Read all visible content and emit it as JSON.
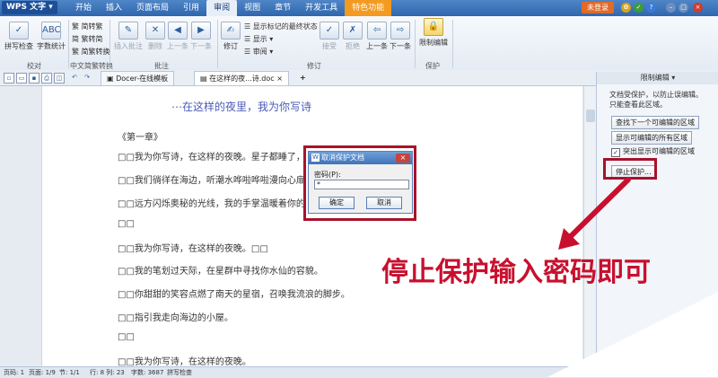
{
  "app": {
    "name": "WPS 文字",
    "login": "未登录"
  },
  "menu_tabs": [
    "开始",
    "插入",
    "页面布局",
    "引用",
    "审阅",
    "视图",
    "章节",
    "开发工具",
    "特色功能"
  ],
  "ribbon": {
    "spell_check": "拼写检查",
    "word_count": "字数统计",
    "proof_group": "校对",
    "simp_to_trad": "简转繁",
    "trad_to_simp": "繁转简",
    "simp_trad_convert": "简繁转换",
    "chinese_group": "中文简繁转换",
    "insert_comment": "插入批注",
    "delete": "删除",
    "prev_comment": "上一条",
    "next_comment": "下一条",
    "comment_group": "批注",
    "revise": "修订",
    "markup_state": "显示标记的最终状态",
    "show": "显示",
    "review": "审阅",
    "accept": "接受",
    "reject": "拒绝",
    "prev_change": "上一条",
    "next_change": "下一条",
    "revision_group": "修订",
    "restrict_edit": "限制编辑",
    "protect_group": "保护"
  },
  "tabs": {
    "docer": "Docer-在线模板",
    "doc": "在这样的夜...诗.doc",
    "new": "+"
  },
  "document": {
    "title": "⋯在这样的夜里，我为你写诗",
    "chapter": "《第一章》",
    "lines": [
      "□□我为你写诗，在这样的夜晚。星子都睡了，",
      "□□我们徜徉在海边，听潮水哗啦哗啦漫向心扉",
      "□□远方闪烁奥秘的光线，我的手掌温暖着你的",
      "□□",
      "□□我为你写诗，在这样的夜晚。□□",
      "□□我的笔划过天际，在星群中寻找你水仙的容貌。",
      "□□你甜甜的笑容点燃了南天的星宿，召唤我流浪的脚步。",
      "□□指引我走向海边的小屋。",
      "□□",
      "□□我为你写诗，在这样的夜晚。"
    ]
  },
  "dialog": {
    "title": "取消保护文档",
    "label": "密码(P):",
    "value": "*",
    "ok": "确定",
    "cancel": "取消"
  },
  "panel": {
    "title": "限制编辑",
    "desc_line1": "文档受保护，以防止误编辑。",
    "desc_line2": "只能查看此区域。",
    "find_next": "查找下一个可编辑的区域",
    "show_all": "显示可编辑的所有区域",
    "highlight": "突出显示可编辑的区域",
    "stop_protect": "停止保护..."
  },
  "annotation": "停止保护输入密码即可",
  "statusbar": {
    "page_no": "页码: 1",
    "pages": "页面: 1/9",
    "section": "节: 1/1",
    "position": "行: 8 列: 23",
    "chars": "字数: 3687",
    "spell": "拼写检查"
  },
  "colors": {
    "highlight_box": "#a8122b",
    "annotation": "#c8102e",
    "accent": "#2f66ad"
  }
}
